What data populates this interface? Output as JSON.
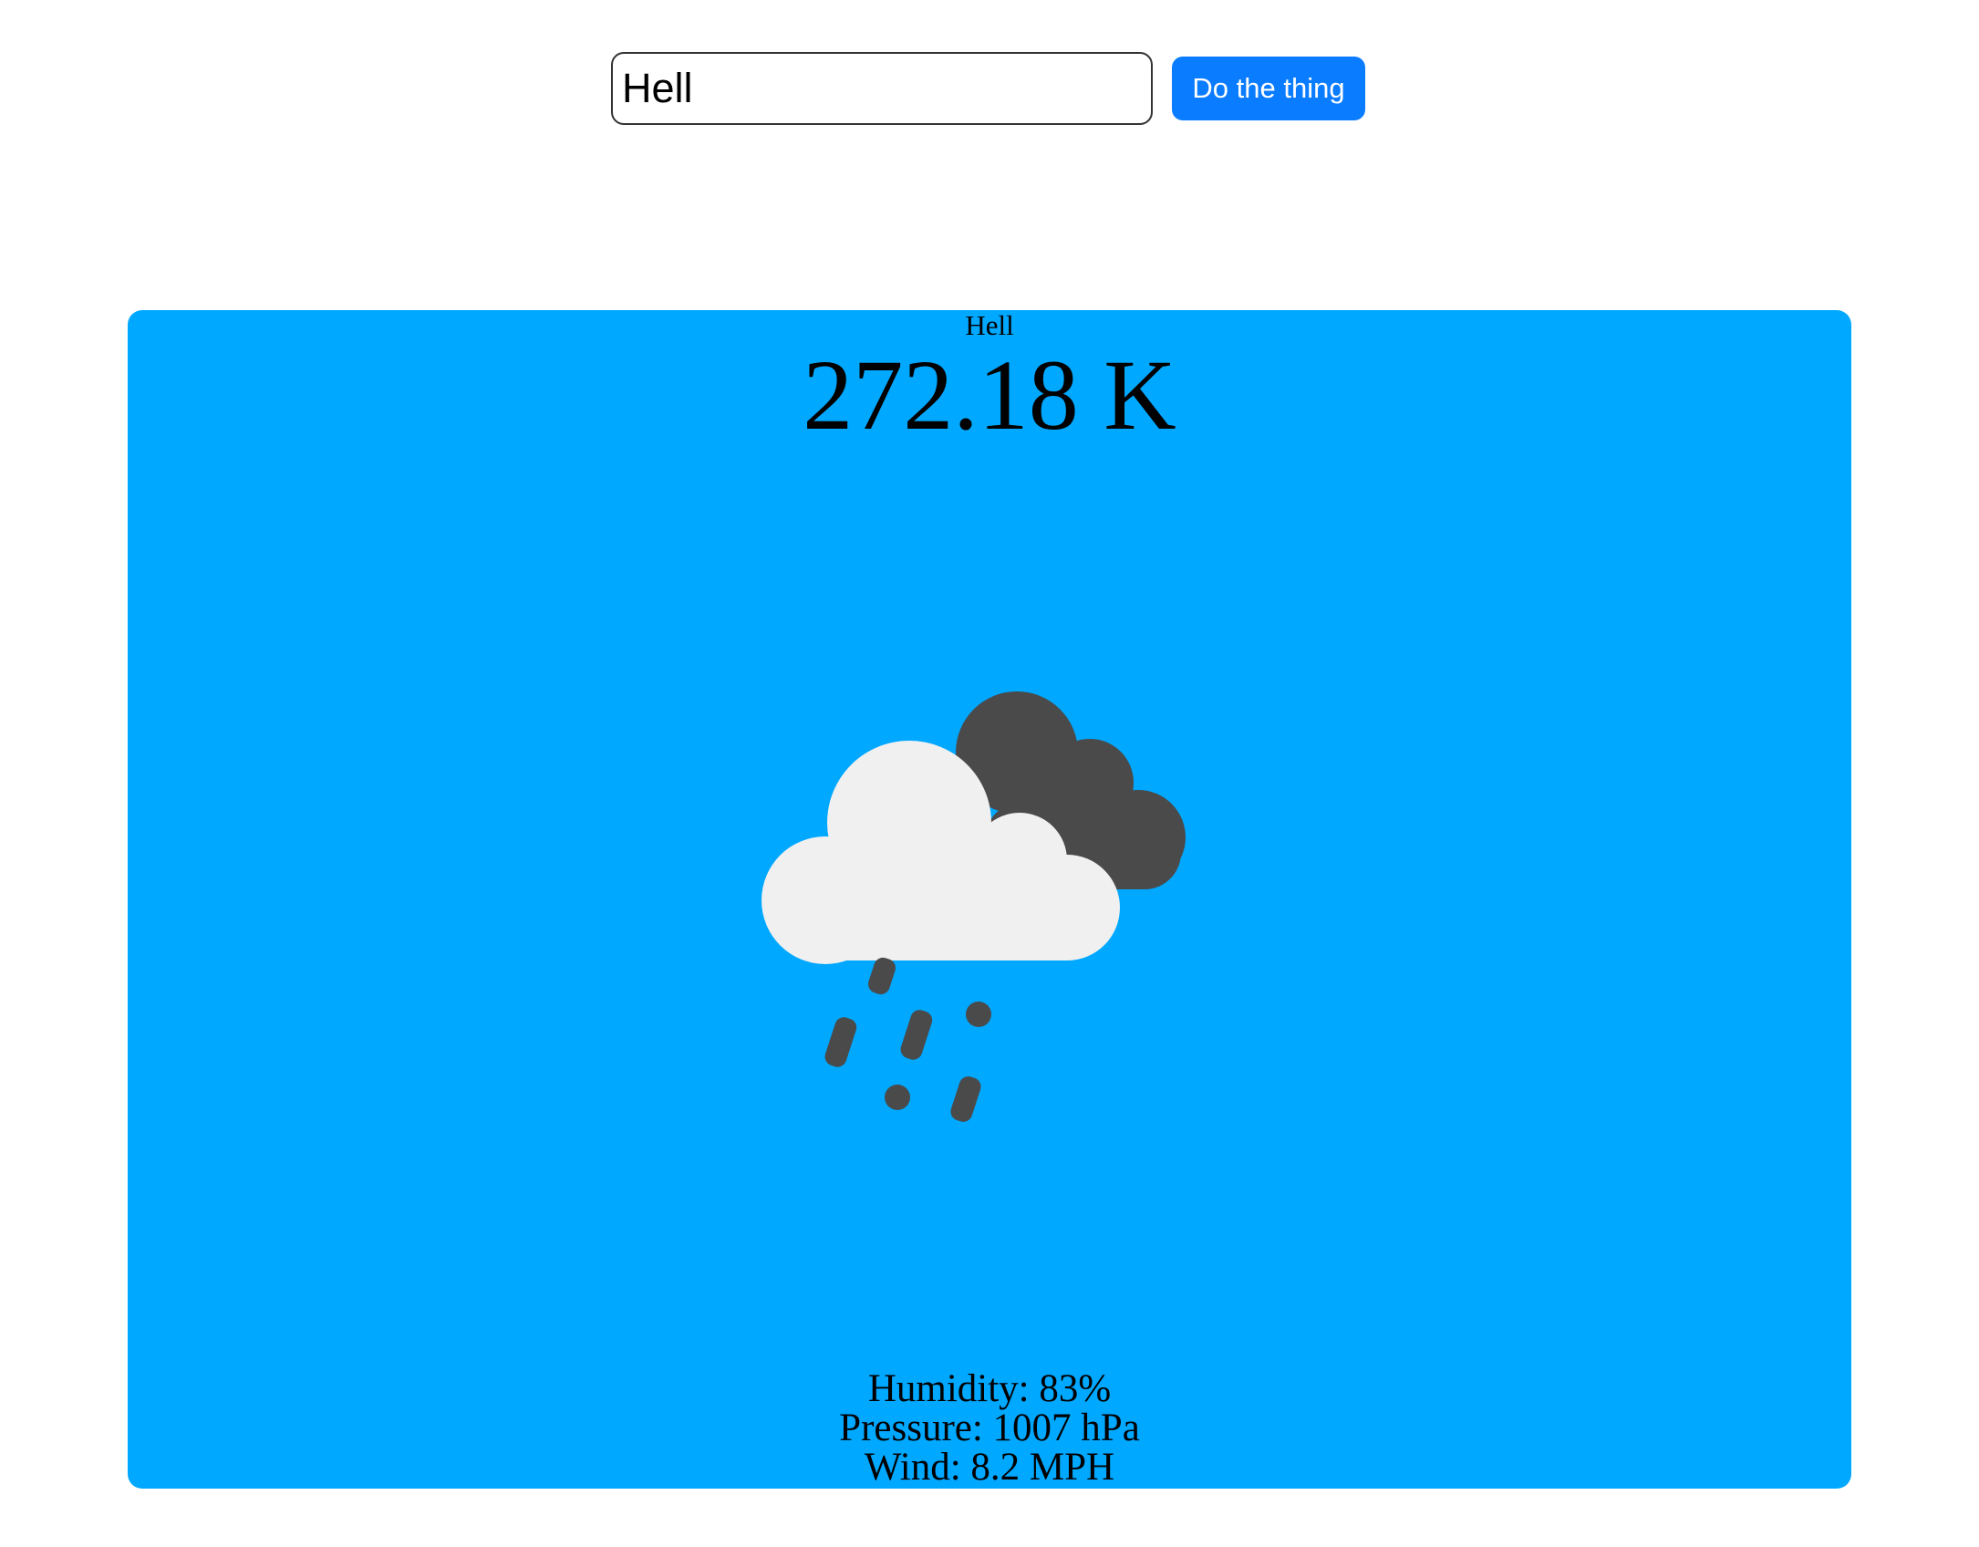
{
  "search": {
    "value": "Hell"
  },
  "action_button": {
    "label": "Do the thing",
    "color": "#0a7cff"
  },
  "weather": {
    "city": "Hell",
    "temperature": "272.18 K",
    "icon": "rain-cloud-icon",
    "card_color": "#00a8ff",
    "humidity": "Humidity: 83%",
    "pressure": "Pressure: 1007 hPa",
    "wind": "Wind: 8.2 MPH"
  }
}
